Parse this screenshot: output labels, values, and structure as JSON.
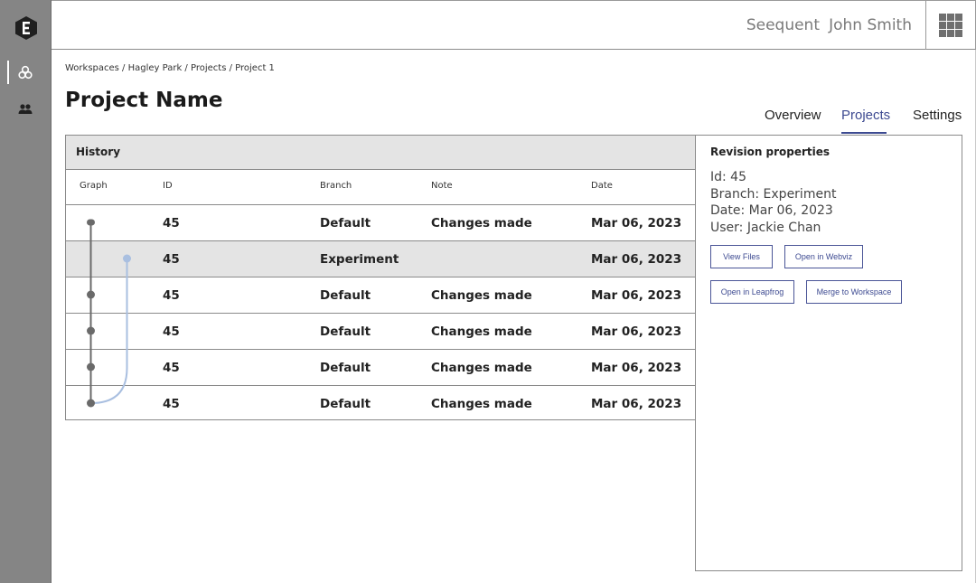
{
  "topbar": {
    "org": "Seequent",
    "user": "John Smith",
    "apps_icon": "grid-icon"
  },
  "rail": {
    "logo_icon": "seequent-logo-icon",
    "items": [
      {
        "icon": "projects-icon"
      },
      {
        "icon": "users-icon"
      }
    ]
  },
  "breadcrumb": [
    "Workspaces",
    "Hagley Park",
    "Projects",
    "Project 1"
  ],
  "breadcrumb_sep": " / ",
  "page_title": "Project Name",
  "tabs": [
    {
      "label": "Overview"
    },
    {
      "label": "Projects",
      "active": true
    },
    {
      "label": "Settings"
    }
  ],
  "history": {
    "title": "History",
    "columns": [
      "Graph",
      "ID",
      "Branch",
      "Note",
      "Date"
    ],
    "rows": [
      {
        "id": "45",
        "branch": "Default",
        "note": "Changes made",
        "date": "Mar 06, 2023"
      },
      {
        "id": "45",
        "branch": "Experiment",
        "note": "",
        "date": "Mar 06, 2023",
        "selected": true
      },
      {
        "id": "45",
        "branch": "Default",
        "note": "Changes made",
        "date": "Mar 06, 2023"
      },
      {
        "id": "45",
        "branch": "Default",
        "note": "Changes made",
        "date": "Mar 06, 2023"
      },
      {
        "id": "45",
        "branch": "Default",
        "note": "Changes made",
        "date": "Mar 06, 2023"
      },
      {
        "id": "45",
        "branch": "Default",
        "note": "Changes made",
        "date": "Mar 06, 2023"
      }
    ]
  },
  "revision": {
    "title": "Revision properties",
    "id_line": "Id: 45",
    "branch_line": "Branch: Experiment",
    "date_line": "Date: Mar 06, 2023",
    "user_line": "User: Jackie Chan",
    "buttons": {
      "view_files": "View Files",
      "open_webviz": "Open in Webviz",
      "open_leapfrog": "Open in Leapfrog",
      "merge": "Merge to Workspace"
    }
  },
  "colors": {
    "accent": "#3d4a91",
    "rail": "#858585",
    "branch_line": "#a9bfe0",
    "main_line": "#6a6a6a"
  }
}
